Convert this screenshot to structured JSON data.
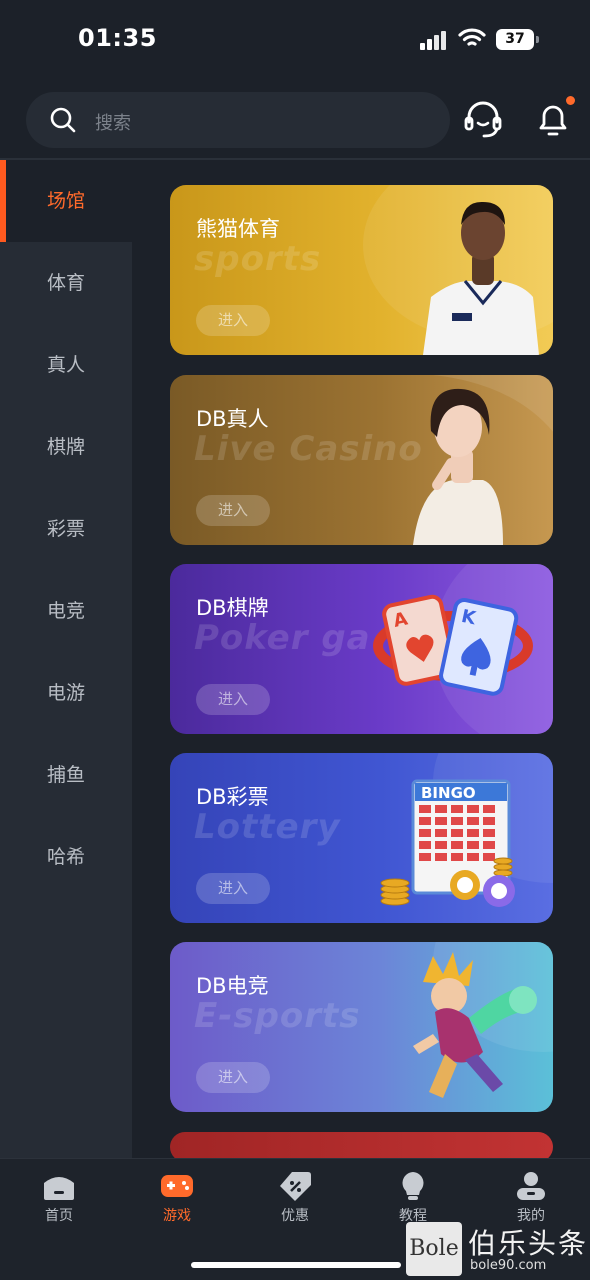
{
  "status_bar": {
    "time": "01:35",
    "battery": "37"
  },
  "search": {
    "placeholder": "搜索"
  },
  "header_icons": [
    "headset-icon",
    "bell-icon"
  ],
  "sidebar": {
    "items": [
      {
        "label": "场馆",
        "active": true
      },
      {
        "label": "体育"
      },
      {
        "label": "真人"
      },
      {
        "label": "棋牌"
      },
      {
        "label": "彩票"
      },
      {
        "label": "电竞"
      },
      {
        "label": "电游"
      },
      {
        "label": "捕鱼"
      },
      {
        "label": "哈希"
      }
    ]
  },
  "cards": [
    {
      "title": "熊猫体育",
      "subtitle": "sports",
      "button": "进入"
    },
    {
      "title": "DB真人",
      "subtitle": "Live Casino",
      "button": "进入"
    },
    {
      "title": "DB棋牌",
      "subtitle": "Poker ga",
      "button": "进入"
    },
    {
      "title": "DB彩票",
      "subtitle": "Lottery",
      "button": "进入"
    },
    {
      "title": "DB电竞",
      "subtitle": "E-sports",
      "button": "进入"
    }
  ],
  "tabbar": {
    "tabs": [
      {
        "label": "首页",
        "icon": "home-icon"
      },
      {
        "label": "游戏",
        "icon": "gamepad-icon",
        "active": true
      },
      {
        "label": "优惠",
        "icon": "discount-tag-icon"
      },
      {
        "label": "教程",
        "icon": "lightbulb-icon"
      },
      {
        "label": "我的",
        "icon": "profile-icon"
      }
    ]
  },
  "watermark": {
    "box_text": "Bole",
    "cn_text": "伯乐头条",
    "url": "bole90.com"
  },
  "colors": {
    "accent": "#ff6a2b",
    "background": "#1c2129",
    "sidebar": "#262c35"
  }
}
